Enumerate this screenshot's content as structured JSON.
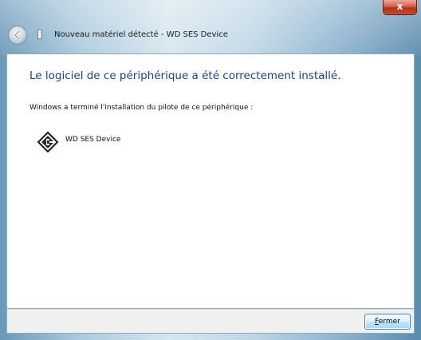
{
  "window": {
    "title": "Nouveau matériel détecté - WD SES Device",
    "close_glyph": "x"
  },
  "content": {
    "heading": "Le logiciel de ce périphérique a été correctement installé.",
    "description": "Windows a terminé l'installation du pilote de ce périphérique :",
    "device": {
      "name": "WD SES Device",
      "icon": "wd-device-icon"
    }
  },
  "footer": {
    "close_button": {
      "mnemonic": "F",
      "rest": "ermer"
    }
  },
  "colors": {
    "heading": "#1e3e8c",
    "close_accent": "#c94a30",
    "button_border": "#3c7fb1"
  }
}
